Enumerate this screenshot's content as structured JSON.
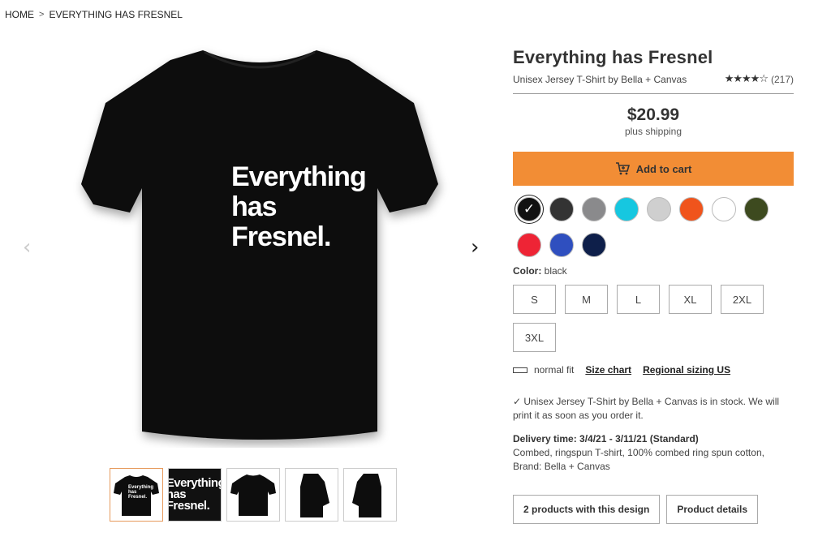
{
  "breadcrumb": {
    "home": "HOME",
    "current": "EVERYTHING HAS FRESNEL"
  },
  "gallery": {
    "shirt_lines": [
      "Everything",
      "has",
      "Fresnel."
    ],
    "prev_arrow": "‹",
    "next_arrow": "›",
    "thumb_lines": [
      "Everything",
      "has",
      "Fresnel."
    ]
  },
  "product": {
    "title": "Everything has Fresnel",
    "subtitle": "Unisex Jersey T-Shirt by Bella + Canvas",
    "stars": "★★★★☆",
    "rating_count": "(217)",
    "price": "$20.99",
    "shipping": "plus shipping",
    "add_to_cart": "Add to cart"
  },
  "colors": {
    "label": "Color:",
    "selected": "black",
    "swatches": [
      "#111111",
      "#333333",
      "#8a8a8c",
      "#16c7e0",
      "#cfcfcf",
      "#f0541c",
      "#ffffff",
      "#3d4a1f",
      "#ee2435",
      "#2f4fbf",
      "#0e1f4a"
    ]
  },
  "sizes": [
    "S",
    "M",
    "L",
    "XL",
    "2XL",
    "3XL"
  ],
  "fit": {
    "text": "normal fit",
    "size_chart": "Size chart",
    "regional": "Regional sizing US"
  },
  "stock": "✓ Unisex Jersey T-Shirt by Bella + Canvas is in stock. We will print it as soon as you order it.",
  "delivery": {
    "label": "Delivery time: 3/4/21 - 3/11/21 (Standard)",
    "description": "Combed, ringspun T-shirt, 100% combed ring spun cotton, Brand: Bella + Canvas"
  },
  "buttons": {
    "products": "2 products with this design",
    "details": "Product details"
  }
}
